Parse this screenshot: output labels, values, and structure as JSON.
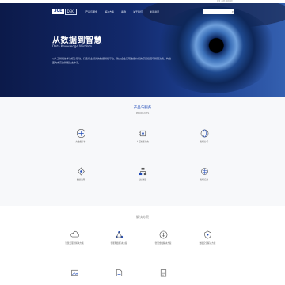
{
  "topbar": {
    "links": "登录 | 注册 | 联系我们"
  },
  "logo": {
    "badge": "3CE",
    "text": "DEKI"
  },
  "nav": {
    "items": [
      {
        "label": "产品与服务"
      },
      {
        "label": "解决方案"
      },
      {
        "label": "案例"
      },
      {
        "label": "关于我们"
      },
      {
        "label": "新闻资讯"
      }
    ]
  },
  "search": {
    "placeholder": ""
  },
  "hero": {
    "title": "从数据到智慧",
    "subtitle": "Data Knowledge Wisdom",
    "description": "以人工智能技术为核心驱动，打造行业领先的数据智能平台，助力企业实现数据价值的深度挖掘与智慧决策，构建面向未来的智能生态体系。"
  },
  "section1": {
    "title": "产品与服务",
    "subtitle": "PRODUCTS",
    "cards": [
      {
        "label": "大数据平台",
        "icon": "database-icon"
      },
      {
        "label": "人工智能平台",
        "icon": "ai-chip-icon"
      },
      {
        "label": "智能分析",
        "icon": "globe-icon"
      },
      {
        "label": "数据治理",
        "icon": "data-flow-icon"
      },
      {
        "label": "知识图谱",
        "icon": "org-chart-icon"
      },
      {
        "label": "智能应用",
        "icon": "brain-icon"
      }
    ]
  },
  "section2": {
    "title": "解决方案",
    "cards": [
      {
        "label": "智慧云服务解决方案",
        "icon": "cloud-icon"
      },
      {
        "label": "智能网络解决方案",
        "icon": "network-icon"
      },
      {
        "label": "智慧金融解决方案",
        "icon": "finance-icon"
      },
      {
        "label": "数据安全解决方案",
        "icon": "security-icon"
      },
      {
        "label": "",
        "icon": "image-icon"
      },
      {
        "label": "",
        "icon": "document-edit-icon"
      },
      {
        "label": "",
        "icon": "clipboard-icon"
      }
    ]
  },
  "colors": {
    "accent": "#1d49b8",
    "heroDark": "#0c1a4a",
    "heroLight": "#3460b0"
  }
}
